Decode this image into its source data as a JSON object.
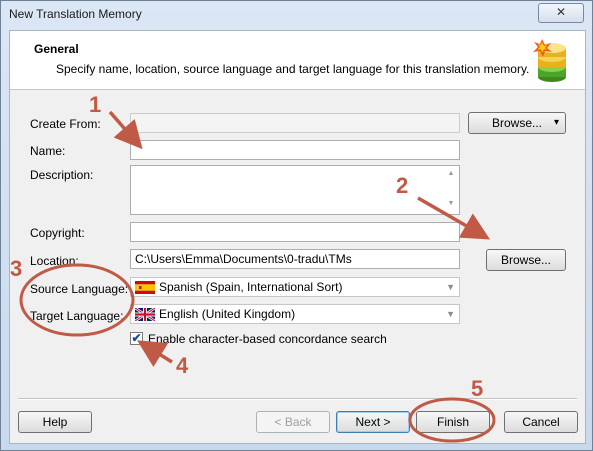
{
  "window": {
    "title": "New Translation Memory",
    "close_glyph": "✕"
  },
  "header": {
    "title": "General",
    "description": "Specify name, location, source language and target language for this translation memory."
  },
  "form": {
    "create_from_label": "Create From:",
    "create_from_value": "",
    "browse1_label": "Browse...",
    "browse1_arrow": "▾",
    "name_label": "Name:",
    "name_value": "",
    "description_label": "Description:",
    "description_value": "",
    "copyright_label": "Copyright:",
    "copyright_value": "",
    "location_label": "Location:",
    "location_value": "C:\\Users\\Emma\\Documents\\0-tradu\\TMs",
    "browse2_label": "Browse...",
    "source_language_label": "Source Language:",
    "source_language_value": "Spanish (Spain, International Sort)",
    "target_language_label": "Target Language:",
    "target_language_value": "English (United Kingdom)",
    "concordance_label": "Enable character-based concordance search",
    "concordance_checked": true,
    "check_glyph": "✔"
  },
  "footer": {
    "help_label": "Help",
    "back_label": "< Back",
    "next_label": "Next >",
    "finish_label": "Finish",
    "cancel_label": "Cancel"
  },
  "annotations": {
    "n1": "1",
    "n2": "2",
    "n3": "3",
    "n4": "4",
    "n5": "5"
  },
  "colors": {
    "annotation": "#c05a46",
    "accent": "#3c7fb1",
    "flag_es_red": "#c60b1e",
    "flag_es_yellow": "#ffc400",
    "flag_uk_blue": "#012169",
    "flag_uk_red": "#c8102e"
  },
  "icons": {
    "header_icon": "translation-memory-database-icon",
    "source_flag": "spain-flag-icon",
    "target_flag": "uk-flag-icon"
  }
}
